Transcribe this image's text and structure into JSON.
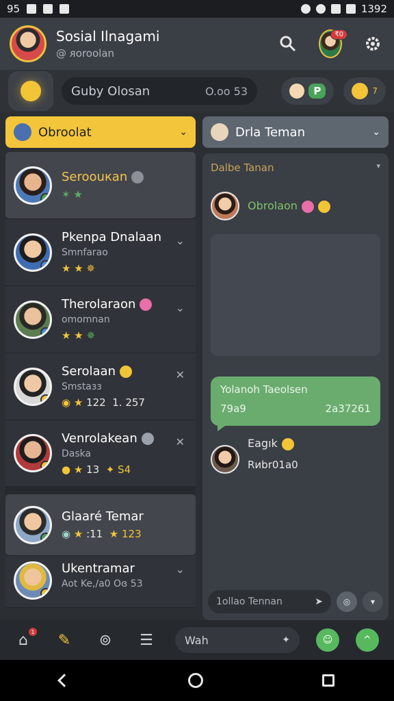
{
  "status_bar": {
    "left_time": "95",
    "right_time": "1392"
  },
  "header": {
    "title": "Sosial Ilnagami",
    "subtitle": "@ ᴙoroolan",
    "notification_badge": "₹0"
  },
  "search": {
    "text": "Guby Olosan",
    "count": "O.oo 53",
    "chip_label": "P",
    "bell_badge": "7"
  },
  "left_section": {
    "label": "Obroolat"
  },
  "chats": [
    {
      "name": "Seroouкan",
      "sub": "",
      "meta": "",
      "status": "green"
    },
    {
      "name": "Pkenpa Dnalaan",
      "sub": "Smnfarao",
      "meta": "",
      "status": "blue"
    },
    {
      "name": "Therolaraon",
      "sub": "omomnan",
      "meta": "",
      "status": "blue"
    },
    {
      "name": "Serolaan",
      "sub": "Smstaзз",
      "meta_left": "122",
      "meta_right": "1. 257",
      "status": "yellow"
    },
    {
      "name": "Venrolakean",
      "sub": "Daska",
      "meta_left": "13",
      "meta_right": "S4",
      "status": "yellow"
    },
    {
      "name": "Glaaré Temar",
      "sub": "",
      "meta_left": ":11",
      "meta_right": "123",
      "status": "green"
    },
    {
      "name": "Ukentramar",
      "sub": "Aot Ke,/a0 Oɞ 53",
      "meta": "",
      "status": "yellow"
    }
  ],
  "right_section": {
    "label": "Drla Teman"
  },
  "panel": {
    "title": "Dalbe Tanan",
    "msg_head": "Obrolaon",
    "bubble_top": "Yolanoh Taeolsen",
    "bubble_left": "79a9",
    "bubble_right": "2a37261",
    "msg2_name": "Eagık",
    "msg2_text": "Rиbr01a0",
    "input_placeholder": "1ollao Tennan"
  },
  "bottom_nav": {
    "home_badge": "1",
    "input_text": "Wah"
  }
}
